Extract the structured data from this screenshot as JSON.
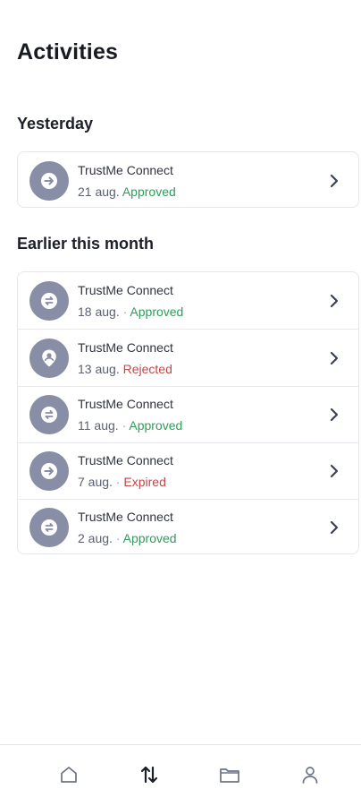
{
  "header": {
    "title": "Activities"
  },
  "sections": [
    {
      "title": "Yesterday",
      "items": [
        {
          "name": "TrustMe Connect",
          "date": "21 aug.",
          "separator": "",
          "status": "Approved",
          "status_kind": "approved",
          "icon": "arrow-right-icon"
        }
      ]
    },
    {
      "title": "Earlier this month",
      "items": [
        {
          "name": "TrustMe Connect",
          "date": "18 aug.",
          "separator": "·",
          "status": "Approved",
          "status_kind": "approved",
          "icon": "transfer-icon"
        },
        {
          "name": "TrustMe Connect",
          "date": "13 aug.",
          "separator": "",
          "status": "Rejected",
          "status_kind": "rejected",
          "icon": "location-pin-icon"
        },
        {
          "name": "TrustMe Connect",
          "date": "11 aug.",
          "separator": "·",
          "status": "Approved",
          "status_kind": "approved",
          "icon": "transfer-icon"
        },
        {
          "name": "TrustMe Connect",
          "date": "7 aug.",
          "separator": "·",
          "status": "Expired",
          "status_kind": "expired",
          "icon": "arrow-right-icon"
        },
        {
          "name": "TrustMe Connect",
          "date": "2 aug.",
          "separator": "·",
          "status": "Approved",
          "status_kind": "approved",
          "icon": "transfer-icon"
        }
      ]
    }
  ],
  "bottom_nav": {
    "items": [
      {
        "icon": "home-icon"
      },
      {
        "icon": "swap-arrows-icon",
        "active": true
      },
      {
        "icon": "folder-icon"
      },
      {
        "icon": "profile-icon"
      }
    ]
  },
  "colors": {
    "approved": "#2e9d5a",
    "rejected": "#c0484a",
    "expired": "#c0484a",
    "avatar": "#878ea5"
  }
}
